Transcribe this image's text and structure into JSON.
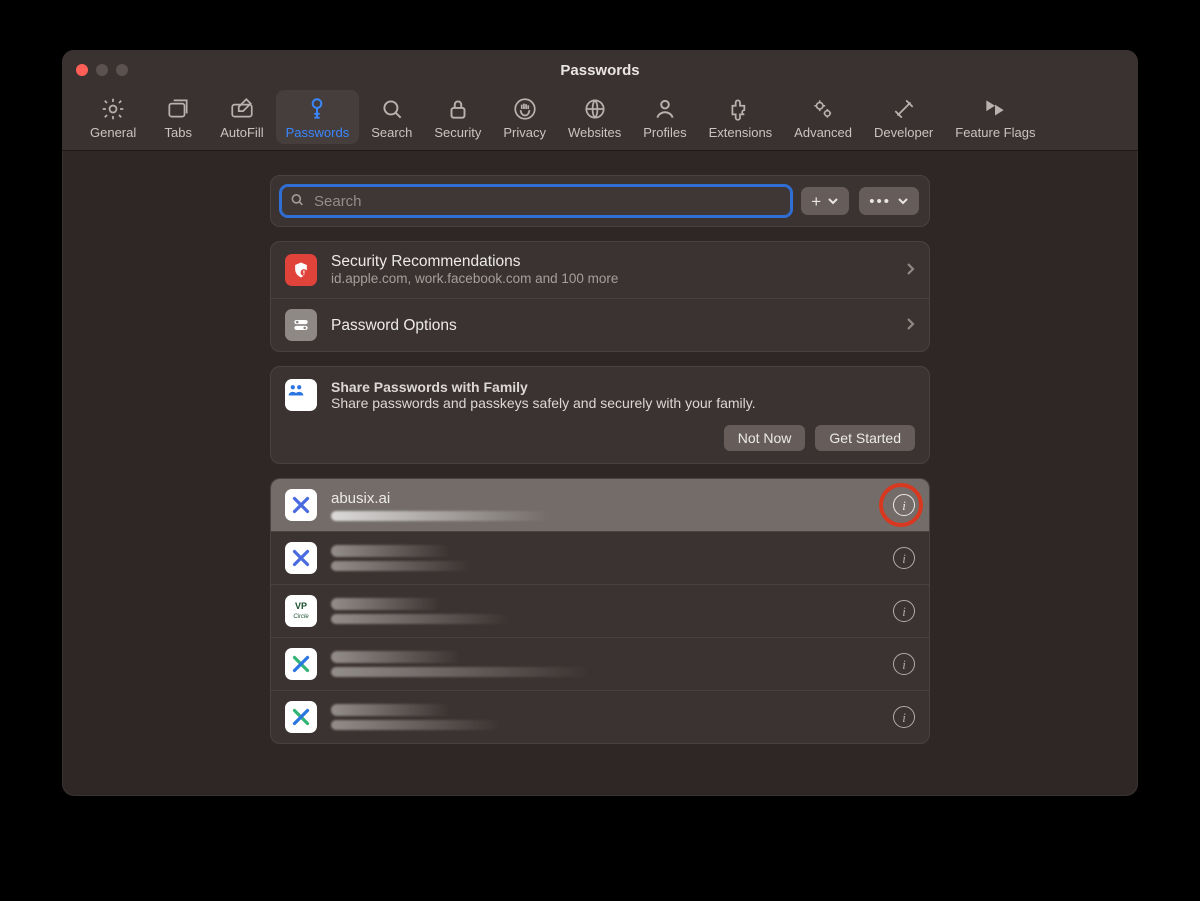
{
  "window": {
    "title": "Passwords"
  },
  "tabs": [
    {
      "label": "General"
    },
    {
      "label": "Tabs"
    },
    {
      "label": "AutoFill"
    },
    {
      "label": "Passwords"
    },
    {
      "label": "Search"
    },
    {
      "label": "Security"
    },
    {
      "label": "Privacy"
    },
    {
      "label": "Websites"
    },
    {
      "label": "Profiles"
    },
    {
      "label": "Extensions"
    },
    {
      "label": "Advanced"
    },
    {
      "label": "Developer"
    },
    {
      "label": "Feature Flags"
    }
  ],
  "search": {
    "placeholder": "Search"
  },
  "recs": {
    "title": "Security Recommendations",
    "subtitle": "id.apple.com, work.facebook.com and 100 more"
  },
  "options": {
    "title": "Password Options"
  },
  "share": {
    "title": "Share Passwords with Family",
    "subtitle": "Share passwords and passkeys safely and securely with your family.",
    "not_now": "Not Now",
    "get_started": "Get Started"
  },
  "entries": [
    {
      "site": "abusix.ai",
      "blur_width": 220,
      "selected": true,
      "icon": "x-blue",
      "highlight_info": true
    },
    {
      "site": "",
      "blur_width": 140,
      "selected": false,
      "icon": "x-blue",
      "title_blur_width": 120
    },
    {
      "site": "",
      "blur_width": 180,
      "selected": false,
      "icon": "vp",
      "title_blur_width": 110
    },
    {
      "site": "",
      "blur_width": 260,
      "selected": false,
      "icon": "x-green",
      "title_blur_width": 130
    },
    {
      "site": "",
      "blur_width": 170,
      "selected": false,
      "icon": "x-green",
      "title_blur_width": 120
    }
  ]
}
